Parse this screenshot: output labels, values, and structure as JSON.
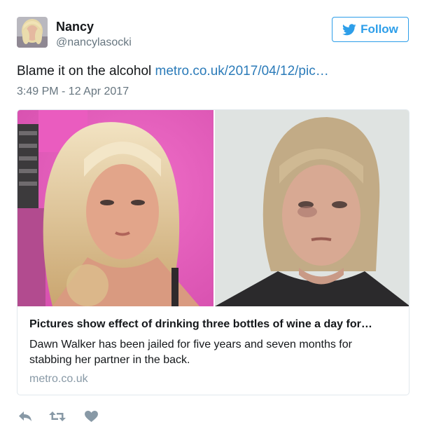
{
  "user": {
    "name": "Nancy",
    "handle": "@nancylasocki",
    "avatar_icon": "profile-photo"
  },
  "follow": {
    "label": "Follow",
    "icon": "twitter-bird-icon",
    "color": "#2d9ee9"
  },
  "tweet": {
    "text": "Blame it on the alcohol ",
    "link_text": "metro.co.uk/2017/04/12/pic…",
    "timestamp": "3:49 PM - 12 Apr 2017"
  },
  "card": {
    "title": "Pictures show effect of drinking three bottles of wine a day for…",
    "description": "Dawn Walker has been jailed for five years and seven months for stabbing her partner in the back.",
    "domain": "metro.co.uk"
  },
  "actions": [
    {
      "name": "reply",
      "icon": "reply-icon"
    },
    {
      "name": "retweet",
      "icon": "retweet-icon"
    },
    {
      "name": "like",
      "icon": "heart-icon"
    }
  ],
  "colors": {
    "link": "#2b7bb9",
    "secondary_text": "#66757f",
    "domain_text": "#8899a6",
    "icon": "#8899a6",
    "border": "#e1e8ed"
  }
}
